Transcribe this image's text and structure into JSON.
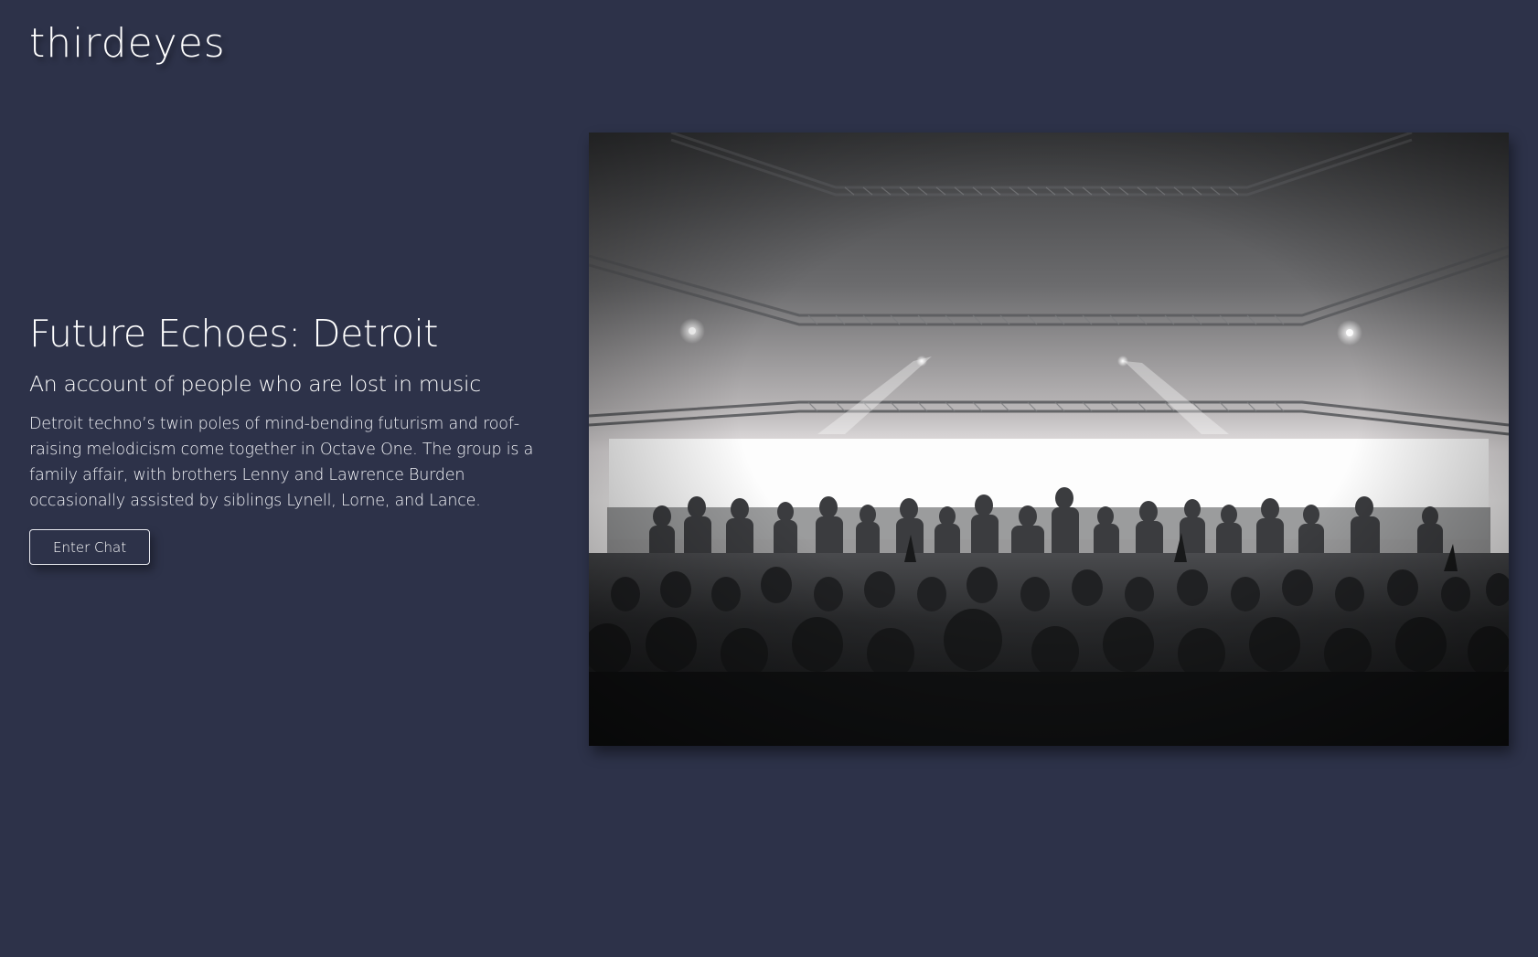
{
  "brand": {
    "logo_text": "thirdeyes"
  },
  "hero": {
    "title": "Future Echoes: Detroit",
    "subtitle": "An account of people who are lost in music",
    "body": "Detroit techno’s twin poles of mind-bending futurism and roof-raising melodicism come together in Octave One. The group is a family affair, with brothers Lenny and Lawrence Burden occasionally assisted by siblings Lynell, Lorne, and Lance.",
    "cta_label": "Enter Chat"
  },
  "colors": {
    "background": "#2d3249",
    "text": "#ffffff",
    "button_border": "#e8e9ef"
  }
}
